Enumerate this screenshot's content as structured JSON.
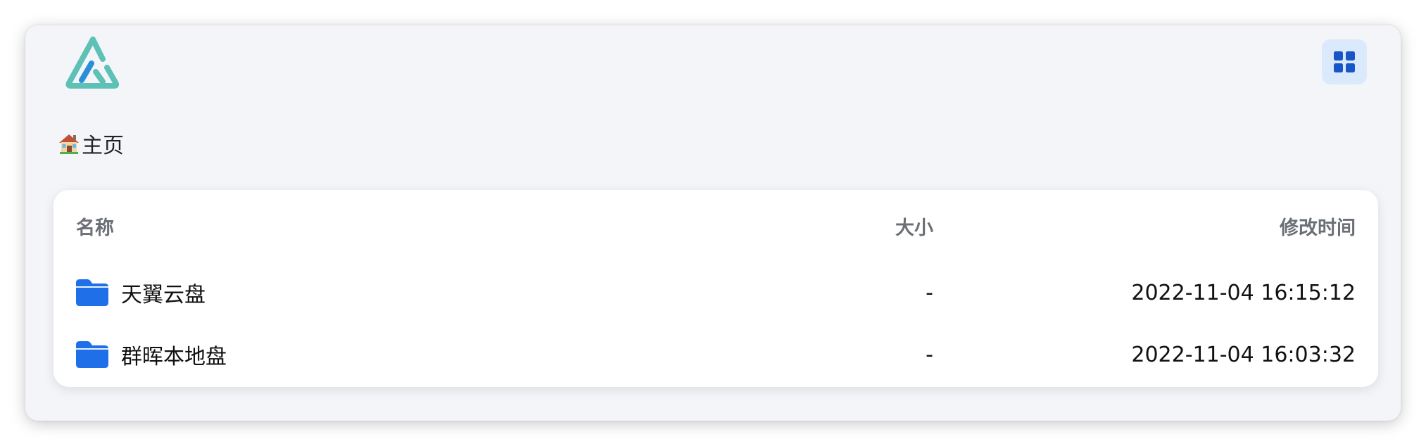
{
  "app": {
    "logo_icon": "alist-logo",
    "view_toggle_icon": "grid-icon",
    "accent_color": "#1f6fe8",
    "logo_colors": [
      "#5dc1b6",
      "#2a8fd8"
    ]
  },
  "breadcrumb": {
    "icon": "house-icon",
    "label": "主页"
  },
  "table": {
    "headers": {
      "name": "名称",
      "size": "大小",
      "modified": "修改时间"
    },
    "rows": [
      {
        "icon": "folder-icon",
        "name": "天翼云盘",
        "size": "-",
        "modified": "2022-11-04 16:15:12"
      },
      {
        "icon": "folder-icon",
        "name": "群晖本地盘",
        "size": "-",
        "modified": "2022-11-04 16:03:32"
      }
    ]
  }
}
